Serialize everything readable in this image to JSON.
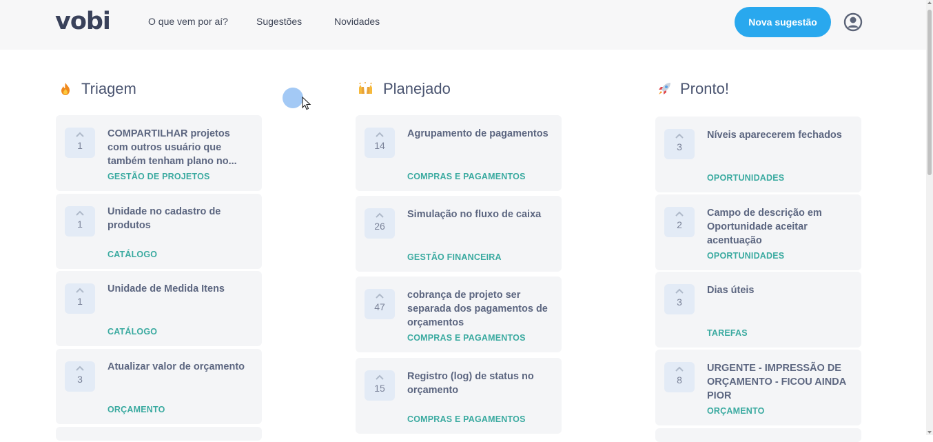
{
  "header": {
    "logo": "vobi",
    "nav": [
      "O que vem por aí?",
      "Sugestões",
      "Novidades"
    ],
    "new_button": "Nova sugestão",
    "avatar_icon": "user-circle-icon",
    "brand_color": "#29a8ee"
  },
  "columns": [
    {
      "title": "Triagem",
      "icon": "fire-icon",
      "cards": [
        {
          "votes": "1",
          "title": "COMPARTILHAR projetos com outros usuário que também tenham plano no...",
          "tag": "GESTÃO DE PROJETOS"
        },
        {
          "votes": "1",
          "title": "Unidade no cadastro de produtos",
          "tag": "CATÁLOGO"
        },
        {
          "votes": "1",
          "title": "Unidade de Medida Itens",
          "tag": "CATÁLOGO"
        },
        {
          "votes": "3",
          "title": "Atualizar valor de orçamento",
          "tag": "ORÇAMENTO"
        }
      ]
    },
    {
      "title": "Planejado",
      "icon": "raised-hands-icon",
      "cards": [
        {
          "votes": "14",
          "title": "Agrupamento de pagamentos",
          "tag": "COMPRAS E PAGAMENTOS"
        },
        {
          "votes": "26",
          "title": "Simulação no fluxo de caixa",
          "tag": "GESTÃO FINANCEIRA"
        },
        {
          "votes": "47",
          "title": "cobrança de projeto ser separada dos pagamentos de orçamentos",
          "tag": "COMPRAS E PAGAMENTOS"
        },
        {
          "votes": "15",
          "title": "Registro (log) de status no orçamento",
          "tag": "COMPRAS E PAGAMENTOS"
        }
      ]
    },
    {
      "title": "Pronto!",
      "icon": "rocket-icon",
      "cards": [
        {
          "votes": "3",
          "title": "Níveis aparecerem fechados",
          "tag": "OPORTUNIDADES"
        },
        {
          "votes": "2",
          "title": "Campo de descrição em Oportunidade aceitar acentuação",
          "tag": "OPORTUNIDADES"
        },
        {
          "votes": "3",
          "title": "Dias úteis",
          "tag": "TAREFAS"
        },
        {
          "votes": "8",
          "title": "URGENTE - IMPRESSÃO DE ORÇAMENTO - FICOU AINDA PIOR",
          "tag": "ORÇAMENTO"
        }
      ]
    }
  ]
}
